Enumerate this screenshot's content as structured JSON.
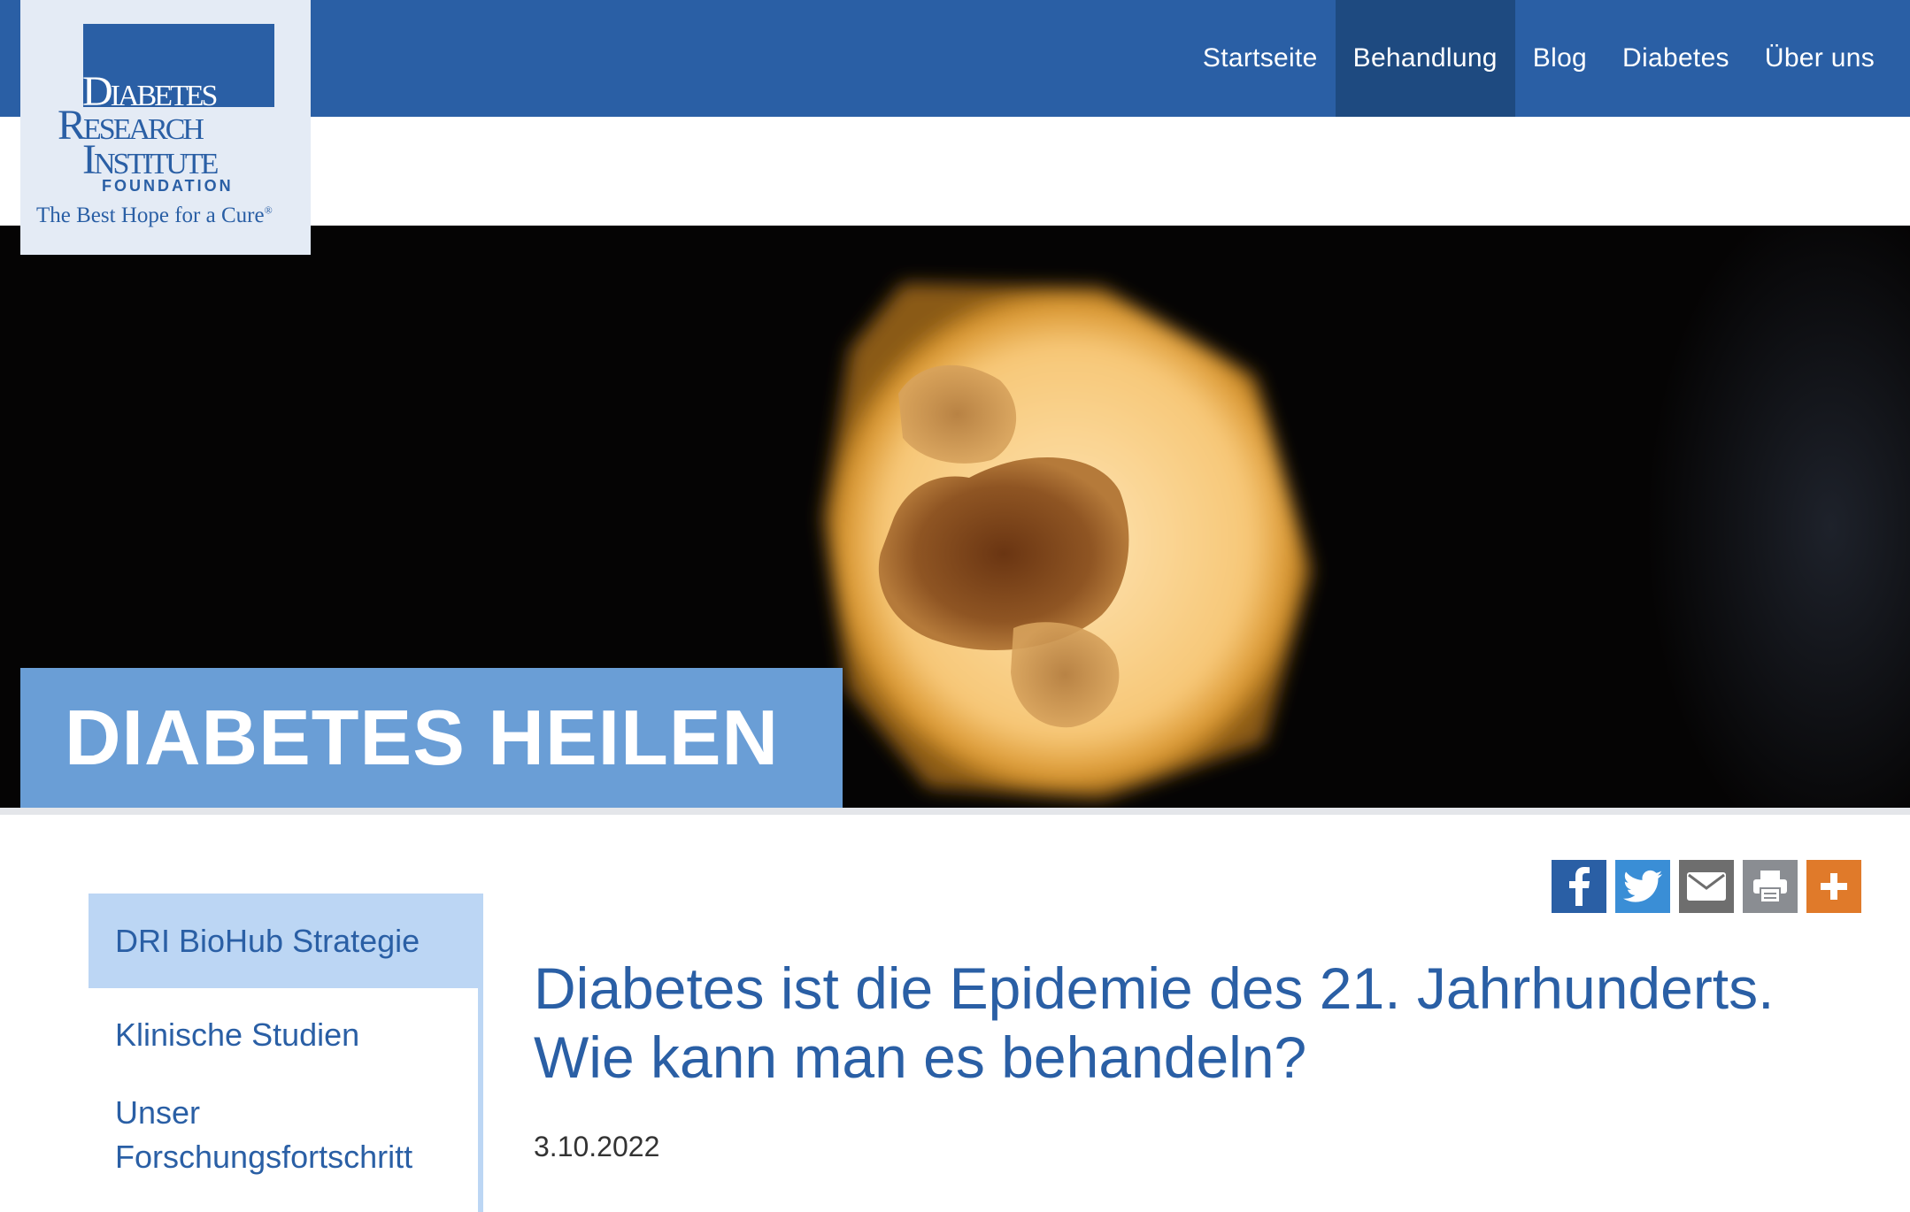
{
  "logo": {
    "line1": "Diabetes",
    "line2": "Research",
    "line3": "Institute",
    "foundation": "FOUNDATION",
    "tagline": "The Best Hope for a Cure",
    "tagline_mark": "®"
  },
  "nav": {
    "items": [
      {
        "label": "Startseite",
        "active": false
      },
      {
        "label": "Behandlung",
        "active": true
      },
      {
        "label": "Blog",
        "active": false
      },
      {
        "label": "Diabetes",
        "active": false
      },
      {
        "label": "Über uns",
        "active": false
      }
    ]
  },
  "hero": {
    "label": "DIABETES HEILEN"
  },
  "sidebar": {
    "items": [
      {
        "label": "DRI BioHub Strategie",
        "active": true
      },
      {
        "label": "Klinische Studien",
        "active": false
      },
      {
        "label": "Unser Forschungsfortschritt",
        "active": false
      }
    ]
  },
  "share": {
    "icons": [
      "facebook-icon",
      "twitter-icon",
      "email-icon",
      "print-icon",
      "plus-icon"
    ]
  },
  "article": {
    "title": "Diabetes ist die Epidemie des 21. Jahrhunderts. Wie kann man es behandeln?",
    "date": "3.10.2022"
  },
  "colors": {
    "brand_blue": "#2a5fa5",
    "nav_active": "#1e4a80",
    "hero_label": "#6a9ed6",
    "sidebar_active": "#bcd6f4"
  }
}
